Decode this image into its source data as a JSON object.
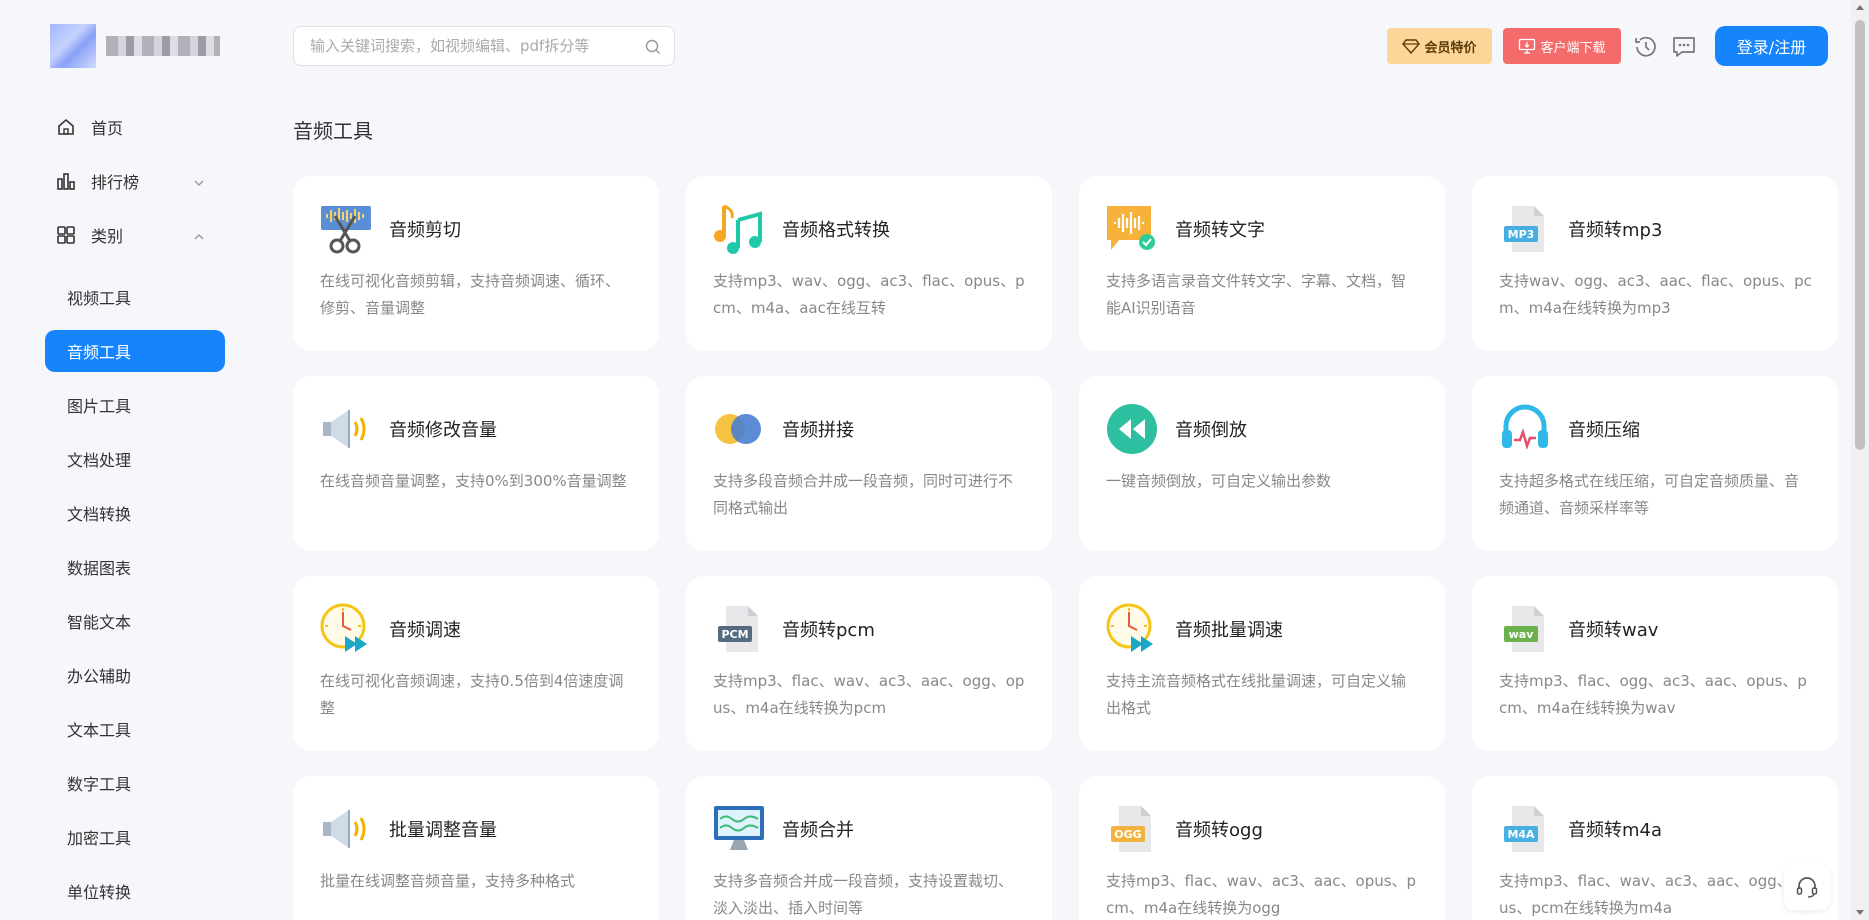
{
  "header": {
    "search_placeholder": "输入关键词搜索，如视频编辑、pdf拆分等",
    "vip_label": "会员特价",
    "download_label": "客户端下载",
    "login_label": "登录/注册"
  },
  "nav": {
    "home": "首页",
    "ranking": "排行榜",
    "category": "类别"
  },
  "categories": [
    {
      "label": "视频工具",
      "active": false
    },
    {
      "label": "音频工具",
      "active": true
    },
    {
      "label": "图片工具",
      "active": false
    },
    {
      "label": "文档处理",
      "active": false
    },
    {
      "label": "文档转换",
      "active": false
    },
    {
      "label": "数据图表",
      "active": false
    },
    {
      "label": "智能文本",
      "active": false
    },
    {
      "label": "办公辅助",
      "active": false
    },
    {
      "label": "文本工具",
      "active": false
    },
    {
      "label": "数字工具",
      "active": false
    },
    {
      "label": "加密工具",
      "active": false
    },
    {
      "label": "单位转换",
      "active": false
    }
  ],
  "section_title": "音频工具",
  "tools": [
    {
      "title": "音频剪切",
      "desc": "在线可视化音频剪辑，支持音频调速、循环、修剪、音量调整",
      "icon": "scissors-audio-icon"
    },
    {
      "title": "音频格式转换",
      "desc": "支持mp3、wav、ogg、ac3、flac、opus、pcm、m4a、aac在线互转",
      "icon": "music-notes-icon"
    },
    {
      "title": "音频转文字",
      "desc": "支持多语言录音文件转文字、字幕、文档，智能AI识别语音",
      "icon": "audio-to-text-icon"
    },
    {
      "title": "音频转mp3",
      "desc": "支持wav、ogg、ac3、aac、flac、opus、pcm、m4a在线转换为mp3",
      "icon": "mp3-file-icon"
    },
    {
      "title": "音频修改音量",
      "desc": "在线音频音量调整，支持0%到300%音量调整",
      "icon": "speaker-icon"
    },
    {
      "title": "音频拼接",
      "desc": "支持多段音频合并成一段音频，同时可进行不同格式输出",
      "icon": "merge-circles-icon"
    },
    {
      "title": "音频倒放",
      "desc": "一键音频倒放，可自定义输出参数",
      "icon": "rewind-icon"
    },
    {
      "title": "音频压缩",
      "desc": "支持超多格式在线压缩，可自定音频质量、音频通道、音频采样率等",
      "icon": "headphones-icon"
    },
    {
      "title": "音频调速",
      "desc": "在线可视化音频调速，支持0.5倍到4倍速度调整",
      "icon": "speed-clock-icon"
    },
    {
      "title": "音频转pcm",
      "desc": "支持mp3、flac、wav、ac3、aac、ogg、opus、m4a在线转换为pcm",
      "icon": "pcm-file-icon"
    },
    {
      "title": "音频批量调速",
      "desc": "支持主流音频格式在线批量调速，可自定义输出格式",
      "icon": "batch-speed-clock-icon"
    },
    {
      "title": "音频转wav",
      "desc": "支持mp3、flac、ogg、ac3、aac、opus、pcm、m4a在线转换为wav",
      "icon": "wav-file-icon"
    },
    {
      "title": "批量调整音量",
      "desc": "批量在线调整音频音量，支持多种格式",
      "icon": "speaker-icon"
    },
    {
      "title": "音频合并",
      "desc": "支持多音频合并成一段音频，支持设置裁切、淡入淡出、插入时间等",
      "icon": "monitor-wave-icon"
    },
    {
      "title": "音频转ogg",
      "desc": "支持mp3、flac、wav、ac3、aac、opus、pcm、m4a在线转换为ogg",
      "icon": "ogg-file-icon"
    },
    {
      "title": "音频转m4a",
      "desc": "支持mp3、flac、wav、ac3、aac、ogg、opus、pcm在线转换为m4a",
      "icon": "m4a-file-icon"
    }
  ],
  "file_badges": {
    "mp3": "MP3",
    "pcm": "PCM",
    "wav": "wav",
    "ogg": "OGG",
    "m4a": "M4A"
  },
  "colors": {
    "accent": "#1684fc",
    "vip": "#fcd698",
    "download": "#f36b6b"
  }
}
